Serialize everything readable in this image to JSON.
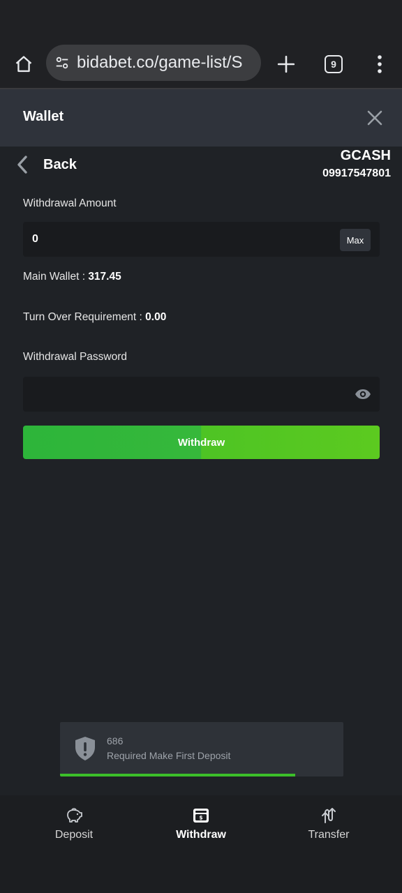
{
  "browser": {
    "url": "bidabet.co/game-list/S",
    "tab_count": "9"
  },
  "wallet": {
    "title": "Wallet"
  },
  "withdraw": {
    "back_label": "Back",
    "method_name": "GCASH",
    "method_number": "09917547801",
    "amount_label": "Withdrawal Amount",
    "amount_value": "0",
    "max_label": "Max",
    "main_wallet_label": "Main Wallet : ",
    "main_wallet_value": "317.45",
    "turnover_label": "Turn Over Requirement : ",
    "turnover_value": "0.00",
    "password_label": "Withdrawal Password",
    "password_value": "",
    "submit_label": "Withdraw"
  },
  "toast": {
    "code": "686",
    "message": "Required Make First Deposit",
    "progress": 0.83
  },
  "bottom_nav": {
    "items": [
      {
        "label": "Deposit",
        "icon": "piggy-bank-icon",
        "active": false
      },
      {
        "label": "Withdraw",
        "icon": "cash-register-icon",
        "active": true
      },
      {
        "label": "Transfer",
        "icon": "transfer-arrows-icon",
        "active": false
      }
    ]
  },
  "colors": {
    "background": "#1f2226",
    "header": "#2f333b",
    "accent_green": "#4ec424",
    "input_bg": "#191b1e"
  }
}
